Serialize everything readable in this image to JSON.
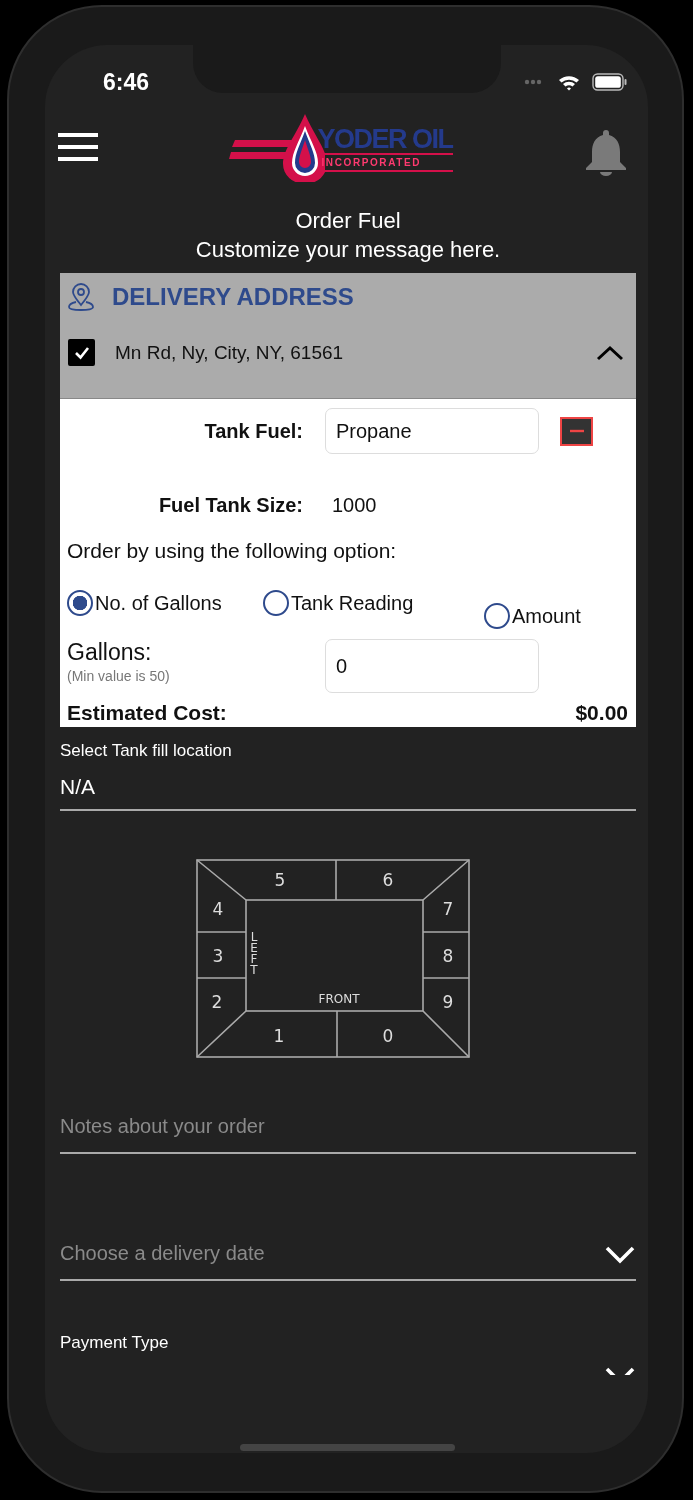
{
  "status_bar": {
    "time": "6:46"
  },
  "header": {
    "logo_name": "YODER OIL",
    "logo_tagline": "INCORPORATED"
  },
  "title": "Order Fuel",
  "subtitle": "Customize your message here.",
  "delivery_address": {
    "heading": "DELIVERY ADDRESS",
    "address": "Mn Rd, Ny, City, NY, 61561",
    "checked": true,
    "expanded": true,
    "tank_fuel": {
      "label": "Tank Fuel:",
      "value": "Propane"
    },
    "tank_size": {
      "label": "Fuel Tank Size:",
      "value": "1000"
    },
    "order_by": {
      "label": "Order by using the following option:",
      "options": [
        {
          "label": "No. of Gallons",
          "selected": true
        },
        {
          "label": "Tank Reading",
          "selected": false
        },
        {
          "label": "Amount",
          "selected": false
        }
      ]
    },
    "gallons": {
      "label": "Gallons:",
      "hint": "(Min value is 50)",
      "value": "0"
    },
    "estimated_cost": {
      "label": "Estimated Cost:",
      "value": "$0.00"
    }
  },
  "fill_location": {
    "label": "Select Tank fill location",
    "value": "N/A",
    "left_label": "LEFT",
    "front_label": "FRONT",
    "zones": [
      {
        "label": "5"
      },
      {
        "label": "6"
      },
      {
        "label": "4"
      },
      {
        "label": "7"
      },
      {
        "label": "3"
      },
      {
        "label": "8"
      },
      {
        "label": "2"
      },
      {
        "label": "9"
      },
      {
        "label": "1"
      },
      {
        "label": "0"
      }
    ]
  },
  "notes": {
    "placeholder": "Notes about your order"
  },
  "delivery_date": {
    "placeholder": "Choose a delivery date"
  },
  "payment": {
    "label": "Payment Type"
  }
}
